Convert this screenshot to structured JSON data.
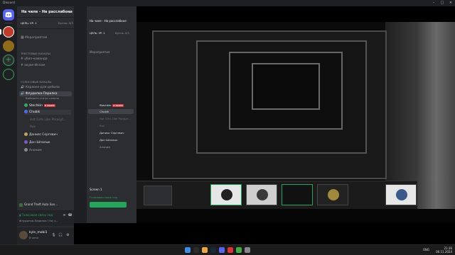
{
  "titlebar": {
    "app_name": "Discord"
  },
  "server": {
    "name": "На чиле - На расслабоне",
    "goal": "ЦЕЛЬ: УР. 1",
    "boosts": "Бусты: 0/3 ›",
    "events": "Мероприятия"
  },
  "categories": {
    "text": "ТЕКСТОВЫЕ КАНАЛЫ",
    "voice": "ГОЛОСОВЫЕ КАНАЛЫ"
  },
  "text_channels": [
    "убил-команда",
    "ахуве-Ислам"
  ],
  "voice_channels": {
    "first": "Караоке-для-дебила",
    "active": "Флудилка-Парилка",
    "active_sub": "Выберите статус канала"
  },
  "voice_users": [
    {
      "name": "Stechkin",
      "live": "В ЭФИРЕ",
      "color": "#3ba55c"
    },
    {
      "name": "Chubik",
      "live": "",
      "color": "#5865f2"
    },
    {
      "name": "Hot Girls Like Parasyt...",
      "live": "",
      "color": "#4e5058",
      "dim": true
    },
    {
      "name": "Rox",
      "live": "",
      "color": "#4e5058",
      "dim": true
    },
    {
      "name": "Данияс Сергевич",
      "live": "",
      "color": "#c4a35a"
    },
    {
      "name": "Дон Шпалык",
      "live": "",
      "color": "#7e5ac4"
    },
    {
      "name": "Аноним",
      "live": "",
      "color": "#888888"
    }
  ],
  "activity": "Grand Theft Auto San...",
  "voice_status": {
    "title": "Голосовая связь под",
    "channel": "Флудилка-Парилка / На ч..."
  },
  "user": {
    "name": "kyle_mobi1",
    "status": "В сети"
  },
  "inner_discord": {
    "server_name": "На чиле - На расслабоне",
    "goal": "ЦЕЛЬ: УР. 1",
    "boosts": "Бусты: 0/3",
    "events": "Мероприятия",
    "screen_label": "Screen 1",
    "voice_label": "Голосовая связь под",
    "users": [
      "Stechkin",
      "Chubik",
      "Hot Girls Like Parasyt...",
      "Rox",
      "Данияс Сергевич",
      "Дон Шпалык",
      "Аноним"
    ],
    "live": "В ЭФИРЕ"
  },
  "game_hud": {
    "price": "218P"
  },
  "taskbar": {
    "time": "21:36",
    "date": "06.11.2024",
    "lang": "ENG"
  }
}
